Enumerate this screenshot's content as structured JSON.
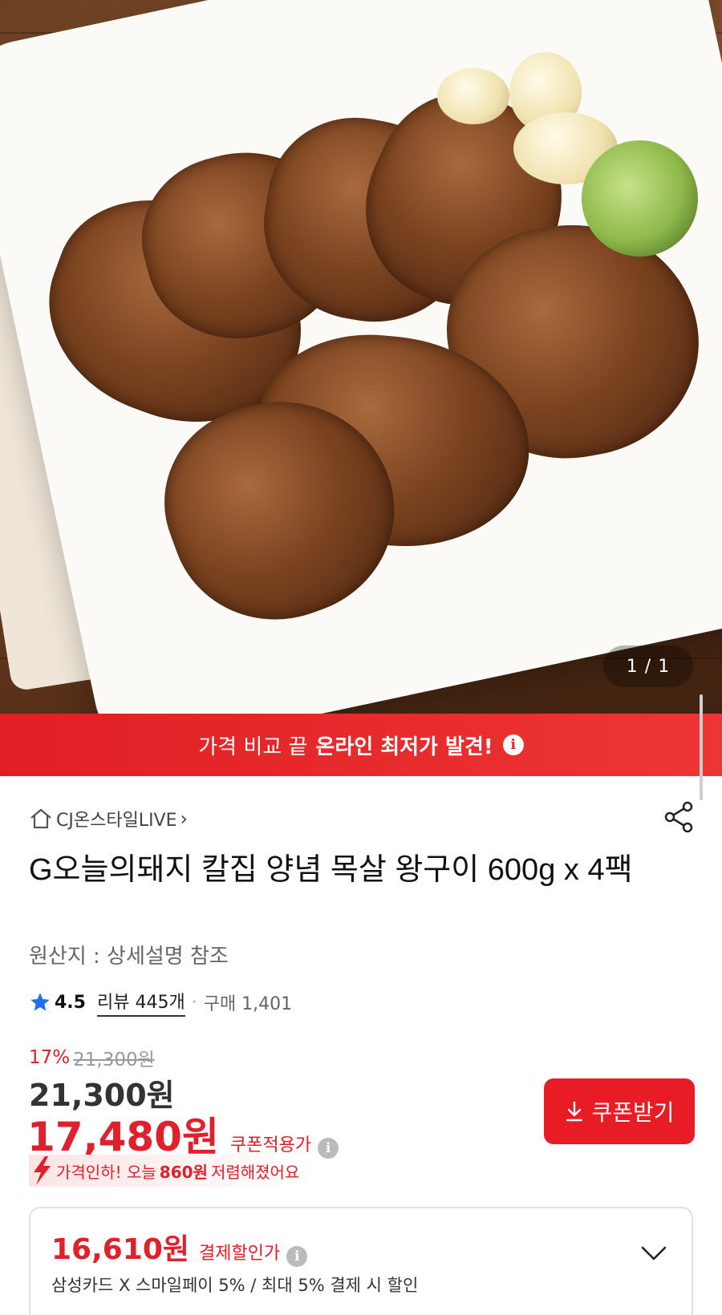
{
  "gallery": {
    "counter": "1 / 1"
  },
  "banner": {
    "normal_text": "가격 비교 끝",
    "bold_text": "온라인 최저가 발견!",
    "info_icon": "info-icon"
  },
  "store": {
    "name": "CJ온스타일LIVE",
    "arrow": "›"
  },
  "product": {
    "title": "G오늘의돼지 칼집 양념 목살 왕구이 600g x 4팩",
    "origin": "원산지 : 상세설명 참조"
  },
  "rating": {
    "score": "4.5",
    "review": "리뷰 445개",
    "dot": "·",
    "purchases": "구매 1,401"
  },
  "price": {
    "discount_pct": "17%",
    "original_strike": "21,300원",
    "main": "21,300원",
    "coupon_price": "17,480원",
    "coupon_label": "쿠폰적용가",
    "coupon_button": "쿠폰받기"
  },
  "price_drop": {
    "prefix": "가격인하! 오늘",
    "amount": "860원",
    "suffix": "저렴해졌어요"
  },
  "payment": {
    "price": "16,610원",
    "label": "결제할인가",
    "description": "삼성카드 X 스마일페이 5% / 최대 5% 결제 시 할인"
  },
  "colors": {
    "accent_red": "#e81c24",
    "banner_red": "#e01f24"
  }
}
